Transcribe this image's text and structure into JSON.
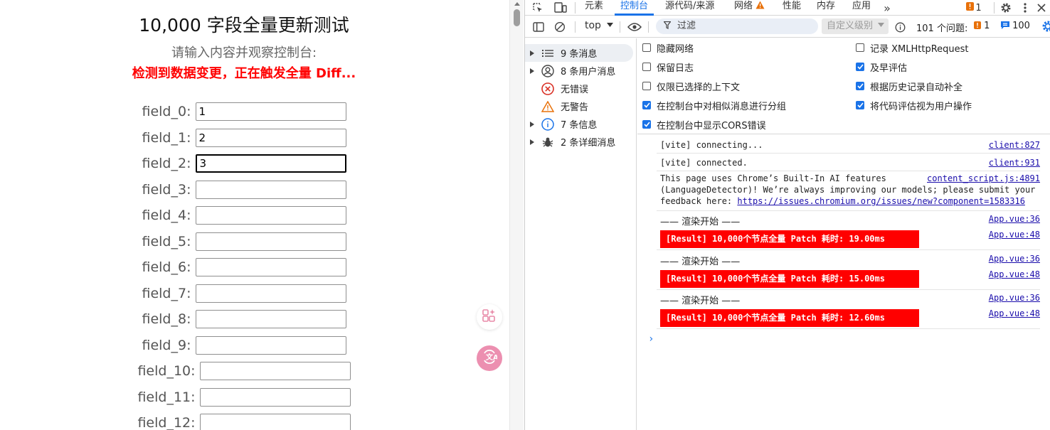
{
  "page": {
    "title": "10,000 字段全量更新测试",
    "prompt": "请输入内容并观察控制台:",
    "status": "检测到数据变更，正在触发全量 Diff...",
    "fields": [
      {
        "label": "field_0:",
        "value": "1"
      },
      {
        "label": "field_1:",
        "value": "2"
      },
      {
        "label": "field_2:",
        "value": "3"
      },
      {
        "label": "field_3:",
        "value": ""
      },
      {
        "label": "field_4:",
        "value": ""
      },
      {
        "label": "field_5:",
        "value": ""
      },
      {
        "label": "field_6:",
        "value": ""
      },
      {
        "label": "field_7:",
        "value": ""
      },
      {
        "label": "field_8:",
        "value": ""
      },
      {
        "label": "field_9:",
        "value": ""
      },
      {
        "label": "field_10:",
        "value": ""
      },
      {
        "label": "field_11:",
        "value": ""
      },
      {
        "label": "field_12:",
        "value": ""
      }
    ],
    "focused_field_index": 2
  },
  "devtools": {
    "tabs": [
      "元素",
      "控制台",
      "源代码/来源",
      "网络",
      "性能",
      "内存",
      "应用"
    ],
    "active_tab": "控制台",
    "issue_badge_count": "1",
    "toolbar": {
      "context": "top",
      "filter_placeholder": "过滤",
      "levels": "自定义级别",
      "issues_label": "101 个问题:",
      "issues_errors": "1",
      "issues_info": "100"
    },
    "sidebar": [
      {
        "label": "9 条消息",
        "icon": "list-icon",
        "expandable": true
      },
      {
        "label": "8 条用户消息",
        "icon": "user-icon",
        "expandable": true
      },
      {
        "label": "无错误",
        "icon": "error-icon",
        "expandable": false
      },
      {
        "label": "无警告",
        "icon": "warning-icon",
        "expandable": false
      },
      {
        "label": "7 条信息",
        "icon": "info-icon",
        "expandable": true
      },
      {
        "label": "2 条详细消息",
        "icon": "bug-icon",
        "expandable": true
      }
    ],
    "settings_left": [
      {
        "label": "隐藏网络",
        "checked": false
      },
      {
        "label": "保留日志",
        "checked": false
      },
      {
        "label": "仅限已选择的上下文",
        "checked": false
      },
      {
        "label": "在控制台中对相似消息进行分组",
        "checked": true
      },
      {
        "label": "在控制台中显示CORS错误",
        "checked": true
      }
    ],
    "settings_right": [
      {
        "label": "记录 XMLHttpRequest",
        "checked": false
      },
      {
        "label": "及早评估",
        "checked": true
      },
      {
        "label": "根据历史记录自动补全",
        "checked": true
      },
      {
        "label": "将代码评估视为用户操作",
        "checked": true
      }
    ],
    "console": {
      "vite_connecting": {
        "text": "[vite] connecting...",
        "source": "client:827"
      },
      "vite_connected": {
        "text": "[vite] connected.",
        "source": "client:931"
      },
      "ai_notice": {
        "line1": "This page uses Chrome’s Built-In AI features",
        "line2": "(LanguageDetector)! We’re always improving our models; please submit your",
        "line3_prefix": "feedback here: ",
        "link": "https://issues.chromium.org/issues/new?component=1583316",
        "source": "content_script.js:4891"
      },
      "render_start_text": "—— 渲染开始 ——",
      "render_start_source": "App.vue:36",
      "result_source": "App.vue:48",
      "results": [
        "[Result] 10,000个节点全量 Patch 耗时: 19.00ms",
        "[Result] 10,000个节点全量 Patch 耗时: 15.00ms",
        "[Result] 10,000个节点全量 Patch 耗时: 12.60ms"
      ]
    }
  }
}
